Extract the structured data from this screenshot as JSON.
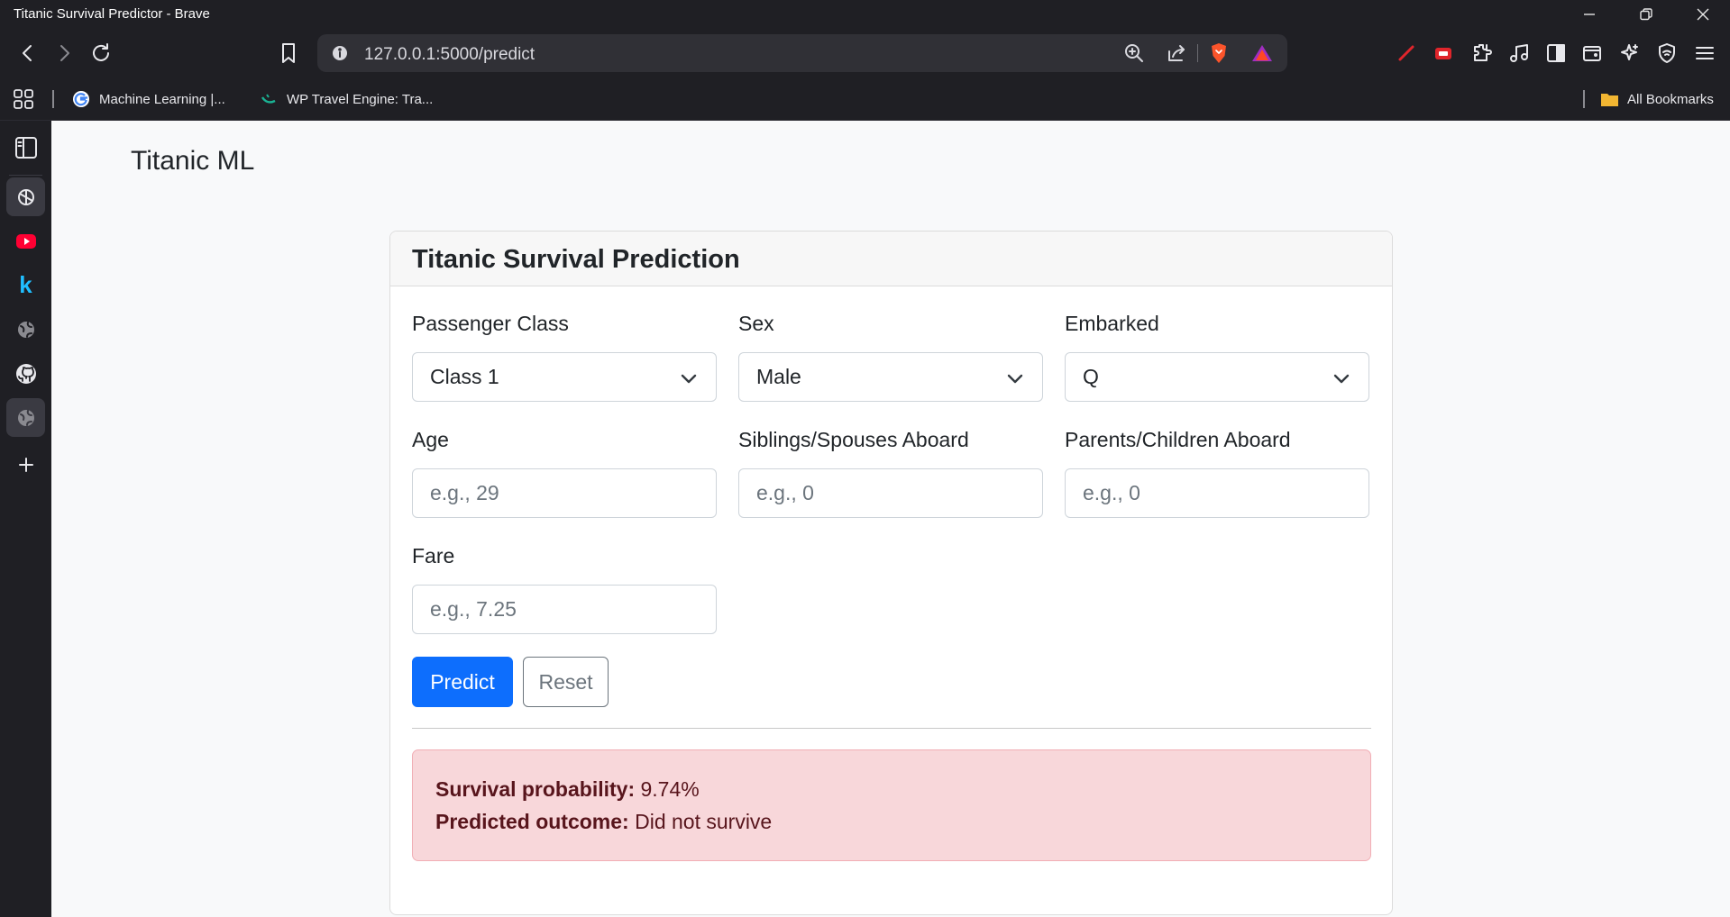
{
  "window": {
    "title": "Titanic Survival Predictor - Brave"
  },
  "toolbar": {
    "url": "127.0.0.1:5000/predict"
  },
  "bookmarks": {
    "items": [
      {
        "label": "Machine Learning  |..."
      },
      {
        "label": "WP Travel Engine: Tra..."
      }
    ],
    "all_bookmarks": "All Bookmarks"
  },
  "page": {
    "brand": "Titanic ML"
  },
  "form": {
    "title": "Titanic Survival Prediction",
    "pclass": {
      "label": "Passenger Class",
      "value": "Class 1"
    },
    "sex": {
      "label": "Sex",
      "value": "Male"
    },
    "embarked": {
      "label": "Embarked",
      "value": "Q"
    },
    "age": {
      "label": "Age",
      "placeholder": "e.g., 29"
    },
    "sibsp": {
      "label": "Siblings/Spouses Aboard",
      "placeholder": "e.g., 0"
    },
    "parch": {
      "label": "Parents/Children Aboard",
      "placeholder": "e.g., 0"
    },
    "fare": {
      "label": "Fare",
      "placeholder": "e.g., 7.25"
    },
    "predict_label": "Predict",
    "reset_label": "Reset"
  },
  "result": {
    "probability_label": "Survival probability:",
    "probability_value": "9.74%",
    "outcome_label": "Predicted outcome:",
    "outcome_value": "Did not survive"
  },
  "colors": {
    "primary": "#0d6efd",
    "alert_bg": "#f8d7da",
    "alert_text": "#58151c",
    "chrome_bg": "#1f1f24"
  },
  "icons": {
    "sidebar": [
      "sidebar-panel-icon",
      "chatgpt-icon",
      "youtube-icon",
      "k-icon",
      "globe-icon",
      "github-icon",
      "globe-icon",
      "plus-icon"
    ]
  }
}
